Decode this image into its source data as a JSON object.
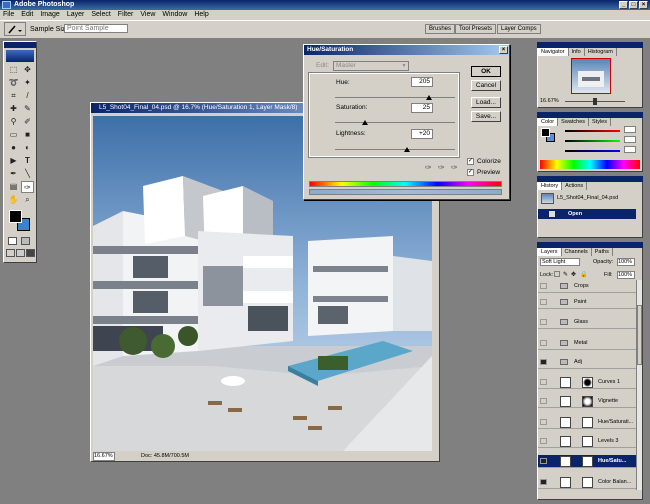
{
  "window": {
    "title": "Adobe Photoshop"
  },
  "menu": [
    "File",
    "Edit",
    "Image",
    "Layer",
    "Select",
    "Filter",
    "View",
    "Window",
    "Help"
  ],
  "options": {
    "sample_label": "Sample Size:",
    "sample_value": "Point Sample"
  },
  "wells": [
    "Brushes",
    "Tool Presets",
    "Layer Comps"
  ],
  "document": {
    "title": "L5_Shot04_Final_04.psd @ 16.7% (Hue/Saturation 1, Layer Mask/8)",
    "zoom": "16.67%",
    "doc_size": "Doc: 45.8M/700.5M"
  },
  "dialog": {
    "title": "Hue/Saturation",
    "edit_label": "Edit:",
    "edit_value": "Master",
    "hue_label": "Hue:",
    "hue_value": "205",
    "hue_level": 0.78,
    "sat_label": "Saturation:",
    "sat_value": "25",
    "sat_level": 0.25,
    "light_label": "Lightness:",
    "light_value": "+20",
    "light_level": 0.6,
    "buttons": [
      "OK",
      "Cancel",
      "Load...",
      "Save..."
    ],
    "colorize_label": "Colorize",
    "preview_label": "Preview"
  },
  "navigator": {
    "tabs": [
      "Navigator",
      "Info",
      "Histogram"
    ],
    "zoom": "16.67%"
  },
  "color": {
    "tabs": [
      "Color",
      "Swatches",
      "Styles"
    ]
  },
  "history": {
    "tabs": [
      "History",
      "Actions"
    ],
    "snapshot": "L5_Shot04_Final_04.psd",
    "item": "Open"
  },
  "layers": {
    "tabs": [
      "Layers",
      "Channels",
      "Paths"
    ],
    "blend_mode": "Soft Light",
    "opacity_label": "Opacity:",
    "opacity": "100%",
    "lock_label": "Lock:",
    "fill_label": "Fill:",
    "fill": "100%",
    "rows": [
      {
        "name": "Crops",
        "type": "folder"
      },
      {
        "name": "Paint",
        "type": "folder"
      },
      {
        "name": "Glass",
        "type": "folder"
      },
      {
        "name": "Metal",
        "type": "folder"
      },
      {
        "name": "Adj",
        "type": "folder-open"
      },
      {
        "name": "Curves 1",
        "type": "adj"
      },
      {
        "name": "Vignette",
        "type": "adj"
      },
      {
        "name": "Hue/Saturati...",
        "type": "adj"
      },
      {
        "name": "Levels 3",
        "type": "adj"
      },
      {
        "name": "Hue/Satu...",
        "type": "adj-selected"
      },
      {
        "name": "Color Balan...",
        "type": "adj"
      }
    ]
  }
}
